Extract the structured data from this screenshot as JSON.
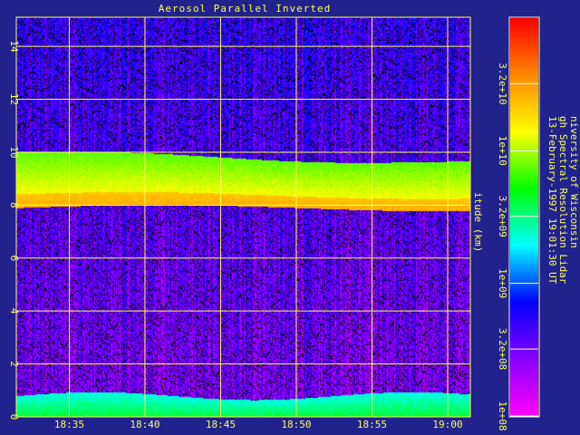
{
  "chart_data": {
    "type": "heatmap",
    "title": "Aerosol Parallel Inverted",
    "ylabel": "itude (km)",
    "xlabel": "",
    "x_ticks": [
      "18:35",
      "18:40",
      "18:45",
      "18:50",
      "18:55",
      "19:00"
    ],
    "y_ticks": [
      "0",
      "2",
      "4",
      "6",
      "8",
      "10",
      "12",
      "14"
    ],
    "x_range": [
      "18:31:30",
      "19:01:30"
    ],
    "y_range_km": [
      0,
      15.1
    ],
    "grid": true,
    "colorbar": {
      "scale": "log",
      "range": [
        "1e+08",
        "1e+11"
      ],
      "ticks": [
        "1e+08",
        "3.2e+08",
        "1e+09",
        "3.2e+09",
        "1e+10",
        "3.2e+10"
      ],
      "colormap": [
        "#ff00ff",
        "#8800ff",
        "#0000ff",
        "#00ffff",
        "#00ff00",
        "#ffff00",
        "#ff8800",
        "#ff0000"
      ]
    },
    "features": [
      {
        "name": "surface aerosol layer",
        "altitude_km": [
          0.0,
          0.8
        ],
        "level": "3.2e+09"
      },
      {
        "name": "elevated aerosol layer",
        "altitude_km": [
          7.9,
          10.0
        ],
        "level": "1e+10"
      }
    ],
    "info_lines": [
      "niversity of Wisconsin",
      "gh Spectral Resolution Lidar",
      "13-February-1997 19:01:30 UT"
    ]
  },
  "colors": {
    "background": "#22228c",
    "text": "#ffff55",
    "grid": "#ffff55"
  }
}
